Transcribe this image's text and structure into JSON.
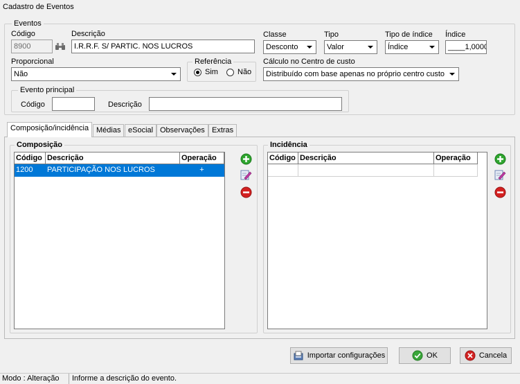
{
  "window": {
    "title": "Cadastro de Eventos"
  },
  "eventos": {
    "legend": "Eventos",
    "codigo": {
      "label": "Código",
      "value": "8900"
    },
    "descricao": {
      "label": "Descrição",
      "value": "I.R.R.F. S/ PARTIC. NOS LUCROS"
    },
    "classe": {
      "label": "Classe",
      "value": "Desconto"
    },
    "tipo": {
      "label": "Tipo",
      "value": "Valor"
    },
    "tipo_indice": {
      "label": "Tipo de índice",
      "value": "Índice"
    },
    "indice": {
      "label": "Índice",
      "value": "____1,0000"
    },
    "proporcional": {
      "label": "Proporcional",
      "value": "Não"
    },
    "referencia": {
      "legend": "Referência",
      "options": [
        "Sim",
        "Não"
      ],
      "selected": "Sim"
    },
    "calculo": {
      "label": "Cálculo no Centro de custo",
      "value": "Distribuído com base apenas no próprio centro custo"
    },
    "evento_principal": {
      "legend": "Evento principal",
      "codigo_label": "Código",
      "codigo_value": "",
      "descricao_label": "Descrição",
      "descricao_value": ""
    }
  },
  "tabs": [
    {
      "label": "Composição/incidência",
      "active": true
    },
    {
      "label": "Médias",
      "active": false
    },
    {
      "label": "eSocial",
      "active": false
    },
    {
      "label": "Observações",
      "active": false
    },
    {
      "label": "Extras",
      "active": false
    }
  ],
  "composicao": {
    "legend": "Composição",
    "columns": [
      "Código",
      "Descrição",
      "Operação"
    ],
    "rows": [
      {
        "codigo": "1200",
        "descricao": "PARTICIPAÇÃO  NOS LUCROS",
        "operacao": "+"
      }
    ]
  },
  "incidencia": {
    "legend": "Incidência",
    "columns": [
      "Código",
      "Descrição",
      "Operação"
    ],
    "rows": []
  },
  "buttons": {
    "importar": "Importar configurações",
    "ok": "OK",
    "cancelar": "Cancela"
  },
  "status": {
    "modo": "Modo : Alteração",
    "mensagem": "Informe a descrição do evento."
  },
  "colors": {
    "selection": "#0078d7",
    "add": "#2fa52f",
    "remove": "#d32121"
  }
}
